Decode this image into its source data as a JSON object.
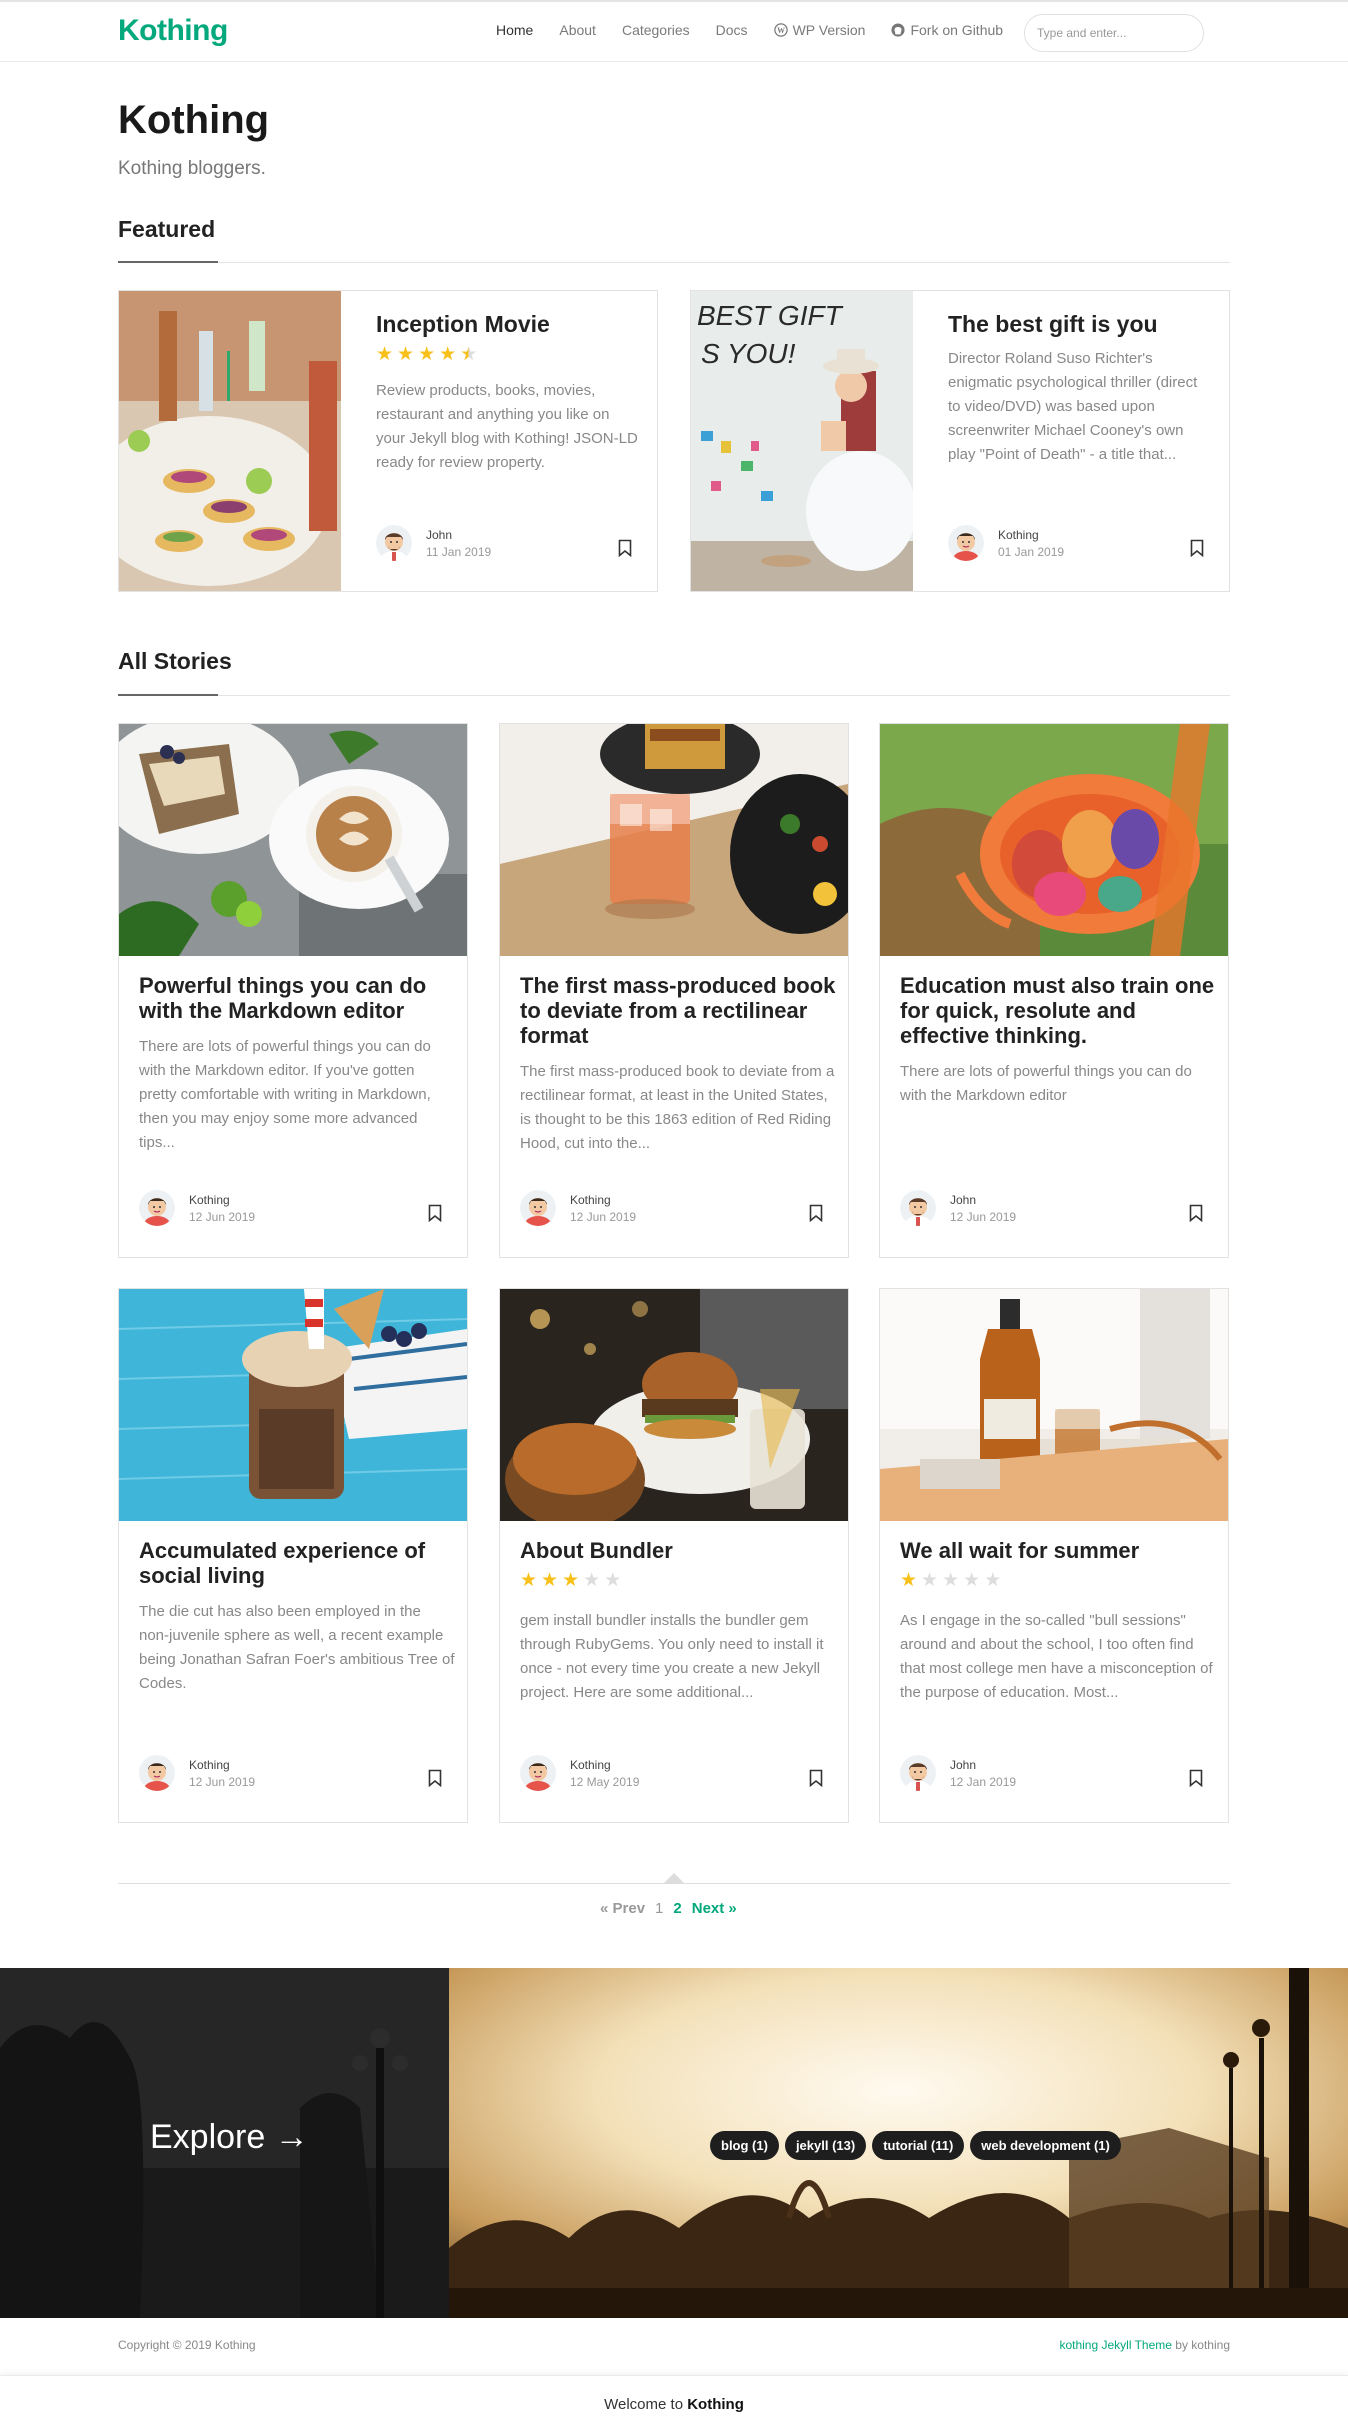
{
  "nav": {
    "brand": "Kothing",
    "links": [
      "Home",
      "About",
      "Categories",
      "Docs",
      "WP Version",
      "Fork on Github"
    ],
    "search_placeholder": "Type and enter..."
  },
  "header": {
    "title": "Kothing",
    "description": "Kothing bloggers."
  },
  "sections": {
    "featured": "Featured",
    "all_stories": "All Stories"
  },
  "featured": [
    {
      "title": "Inception Movie",
      "rating": 4.5,
      "text": "Review products, books, movies, restaurant and anything you like on your Jekyll blog with Kothing! JSON-LD ready for review property.",
      "author": "John",
      "date": "11 Jan 2019"
    },
    {
      "title": "The best gift is you",
      "text": "Director Roland Suso Richter's enigmatic psychological thriller (direct to video/DVD) was based upon screenwriter Michael Cooney's own play \"Point of Death\" - a title that...",
      "author": "Kothing",
      "date": "01 Jan 2019"
    }
  ],
  "stories": [
    {
      "title": "Powerful things you can do with the Markdown editor",
      "text": "There are lots of powerful things you can do with the Markdown editor. If you've gotten pretty comfortable with writing in Markdown, then you may enjoy some more advanced tips...",
      "author": "Kothing",
      "date": "12 Jun 2019"
    },
    {
      "title": "The first mass-produced book to deviate from a rectilinear format",
      "text": "The first mass-produced book to deviate from a rectilinear format, at least in the United States, is thought to be this 1863 edition of Red Riding Hood, cut into the...",
      "author": "Kothing",
      "date": "12 Jun 2019"
    },
    {
      "title": "Education must also train one for quick, resolute and effective thinking.",
      "text": "There are lots of powerful things you can do with the Markdown editor",
      "author": "John",
      "date": "12 Jun 2019"
    },
    {
      "title": "Accumulated experience of social living",
      "text": "The die cut has also been employed in the non-juvenile sphere as well, a recent example being Jonathan Safran Foer's ambitious Tree of Codes.",
      "author": "Kothing",
      "date": "12 Jun 2019"
    },
    {
      "title": "About Bundler",
      "rating": 3,
      "text": "gem install bundler installs the bundler gem through RubyGems. You only need to install it once - not every time you create a new Jekyll project. Here are some additional...",
      "author": "Kothing",
      "date": "12 May 2019"
    },
    {
      "title": "We all wait for summer",
      "rating": 1,
      "text": "As I engage in the so-called \"bull sessions\" around and about the school, I too often find that most college men have a misconception of the purpose of education. Most...",
      "author": "John",
      "date": "12 Jan 2019"
    }
  ],
  "pagination": {
    "prev": "« Prev",
    "pages": [
      "1",
      "2"
    ],
    "current": "2",
    "next": "Next »"
  },
  "jumbotron": {
    "explore": "Explore →",
    "tags": [
      "blog (1)",
      "jekyll (13)",
      "tutorial (11)",
      "web development (1)"
    ]
  },
  "footer": {
    "copyright": "Copyright © 2019 Kothing",
    "theme_link": "kothing Jekyll Theme",
    "theme_by": " by kothing"
  },
  "welcome": {
    "prefix": "Welcome to ",
    "name": "Kothing"
  },
  "colors": {
    "brand": "#03a87c",
    "star": "#f7c01b"
  }
}
